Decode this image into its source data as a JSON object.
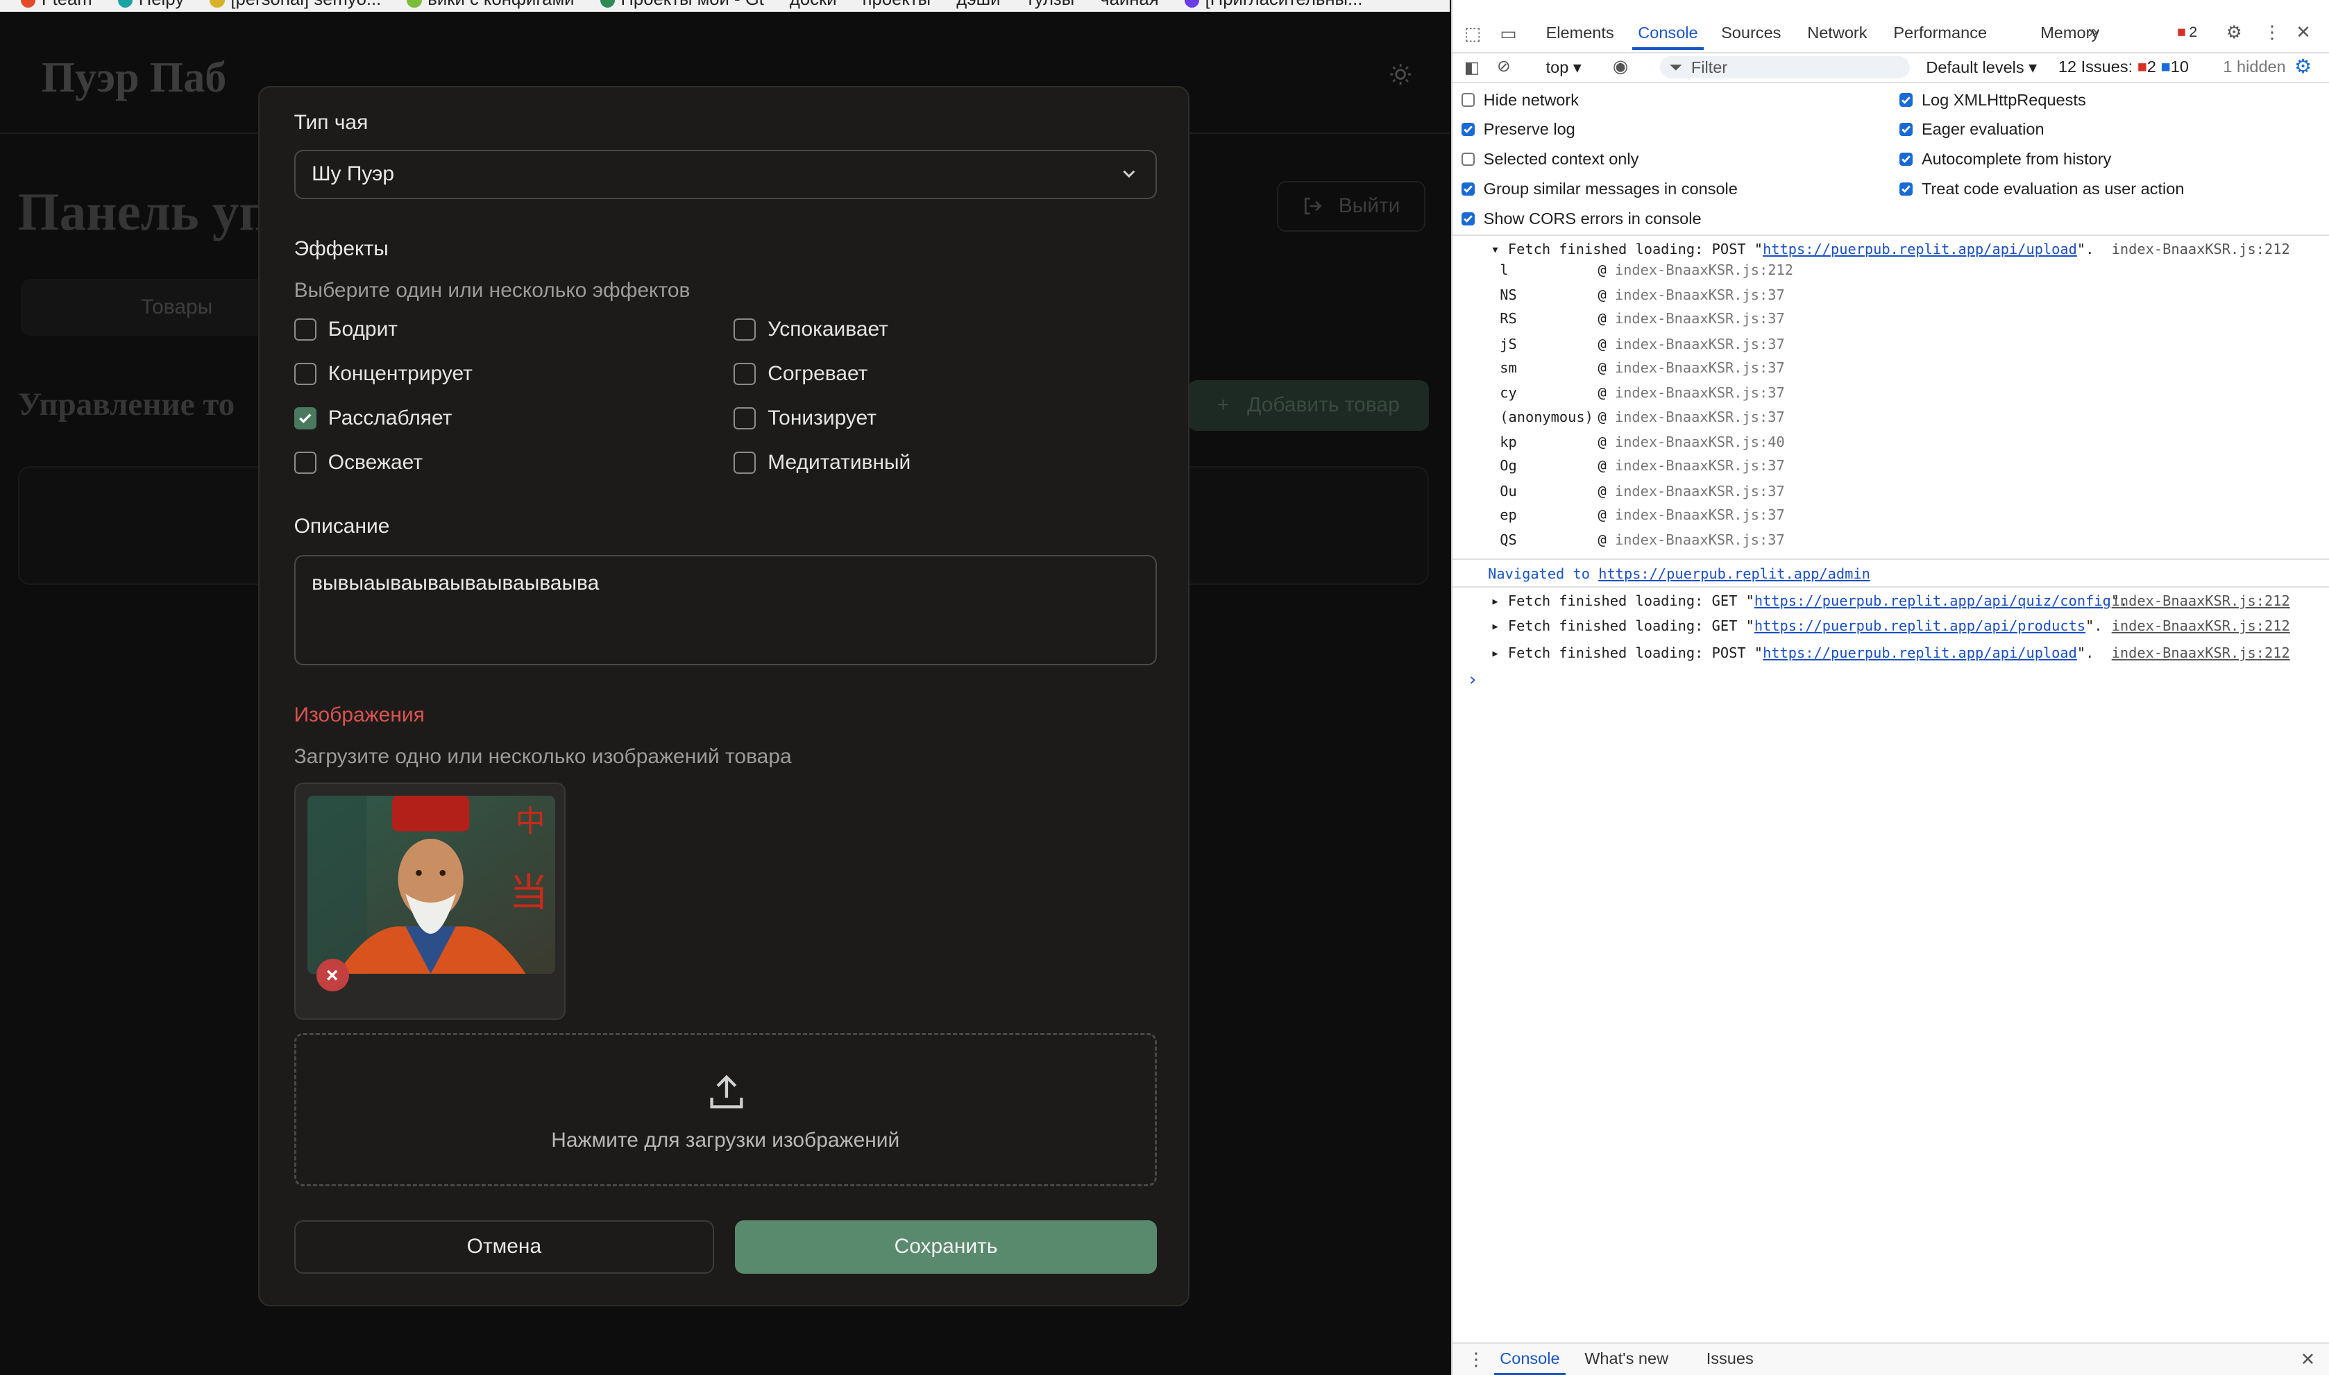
{
  "bookmarks": [
    {
      "label": "Fteam",
      "color": "#e24a2b"
    },
    {
      "label": "Helpy",
      "color": "#1aa3a3"
    },
    {
      "label": "[personal] semyo...",
      "color": "#d9b22b"
    },
    {
      "label": "вики с конфигами",
      "color": "#7bbd3a"
    },
    {
      "label": "Проекты мои - Gt",
      "color": "#2e8b57"
    },
    {
      "label": "доски",
      "color": "#888888"
    },
    {
      "label": "проекты",
      "color": "#888888"
    },
    {
      "label": "дэши",
      "color": "#888888"
    },
    {
      "label": "тулзы",
      "color": "#888888"
    },
    {
      "label": "чайная",
      "color": "#888888"
    },
    {
      "label": "[Пригласительны...",
      "color": "#6a3de8"
    }
  ],
  "app": {
    "logo": "Пуэр Паб",
    "admin_title": "Панель уп",
    "logout_label": "Выйти",
    "tab_products": "Товары",
    "section_title": "Управление то",
    "add_product_label": "Добавить товар"
  },
  "modal": {
    "tea_type_label": "Тип чая",
    "tea_type_value": "Шу Пуэр",
    "effects_label": "Эффекты",
    "effects_hint": "Выберите один или несколько эффектов",
    "effects": [
      {
        "label": "Бодрит",
        "checked": false
      },
      {
        "label": "Успокаивает",
        "checked": false
      },
      {
        "label": "Концентрирует",
        "checked": false
      },
      {
        "label": "Согревает",
        "checked": false
      },
      {
        "label": "Расслабляет",
        "checked": true
      },
      {
        "label": "Тонизирует",
        "checked": false
      },
      {
        "label": "Освежает",
        "checked": false
      },
      {
        "label": "Медитативный",
        "checked": false
      }
    ],
    "description_label": "Описание",
    "description_value": "вывыаываываываываываыва",
    "images_label": "Изображения",
    "images_hint": "Загрузите одно или несколько изображений товара",
    "upload_text": "Нажмите для загрузки изображений",
    "cancel_label": "Отмена",
    "save_label": "Сохранить",
    "colors": {
      "accent": "#5a8a6e",
      "error": "#d9534f",
      "bg": "#1d1b19"
    }
  },
  "devtools": {
    "tabs": [
      "Elements",
      "Console",
      "Sources",
      "Network",
      "Performance",
      "Memory"
    ],
    "active_tab": "Console",
    "error_count": "2",
    "context": "top",
    "filter_placeholder": "Filter",
    "levels": "Default levels",
    "issues_label": "12 Issues:",
    "issues_errors": "2",
    "issues_info": "10",
    "hidden": "1 hidden",
    "options_left": [
      {
        "label": "Hide network",
        "checked": false
      },
      {
        "label": "Preserve log",
        "checked": true
      },
      {
        "label": "Selected context only",
        "checked": false
      },
      {
        "label": "Group similar messages in console",
        "checked": true
      },
      {
        "label": "Show CORS errors in console",
        "checked": true
      }
    ],
    "options_right": [
      {
        "label": "Log XMLHttpRequests",
        "checked": true
      },
      {
        "label": "Eager evaluation",
        "checked": true
      },
      {
        "label": "Autocomplete from history",
        "checked": true
      },
      {
        "label": "Treat code evaluation as user action",
        "checked": true
      }
    ],
    "first_log": {
      "prefix": "Fetch finished loading: POST \"",
      "url": "https://puerpub.replit.app/api/upload",
      "suffix": "\".",
      "source": "index-BnaaxKSR.js:212"
    },
    "stack": [
      {
        "fn": "l",
        "loc": "index-BnaaxKSR.js:212"
      },
      {
        "fn": "NS",
        "loc": "index-BnaaxKSR.js:37"
      },
      {
        "fn": "RS",
        "loc": "index-BnaaxKSR.js:37"
      },
      {
        "fn": "jS",
        "loc": "index-BnaaxKSR.js:37"
      },
      {
        "fn": "sm",
        "loc": "index-BnaaxKSR.js:37"
      },
      {
        "fn": "cy",
        "loc": "index-BnaaxKSR.js:37"
      },
      {
        "fn": "(anonymous)",
        "loc": "index-BnaaxKSR.js:37"
      },
      {
        "fn": "kp",
        "loc": "index-BnaaxKSR.js:40"
      },
      {
        "fn": "Og",
        "loc": "index-BnaaxKSR.js:37"
      },
      {
        "fn": "Ou",
        "loc": "index-BnaaxKSR.js:37"
      },
      {
        "fn": "ep",
        "loc": "index-BnaaxKSR.js:37"
      },
      {
        "fn": "QS",
        "loc": "index-BnaaxKSR.js:37"
      }
    ],
    "navigated_prefix": "Navigated to ",
    "navigated_url": "https://puerpub.replit.app/admin",
    "logs": [
      {
        "prefix": "Fetch finished loading: GET \"",
        "url": "https://puerpub.replit.app/api/quiz/config",
        "suffix": "\".",
        "source": "index-BnaaxKSR.js:212"
      },
      {
        "prefix": "Fetch finished loading: GET \"",
        "url": "https://puerpub.replit.app/api/products",
        "suffix": "\".",
        "source": "index-BnaaxKSR.js:212"
      },
      {
        "prefix": "Fetch finished loading: POST \"",
        "url": "https://puerpub.replit.app/api/upload",
        "suffix": "\".",
        "source": "index-BnaaxKSR.js:212"
      }
    ],
    "prompt": "›",
    "drawer_tabs": [
      "Console",
      "What's new",
      "Issues"
    ]
  }
}
